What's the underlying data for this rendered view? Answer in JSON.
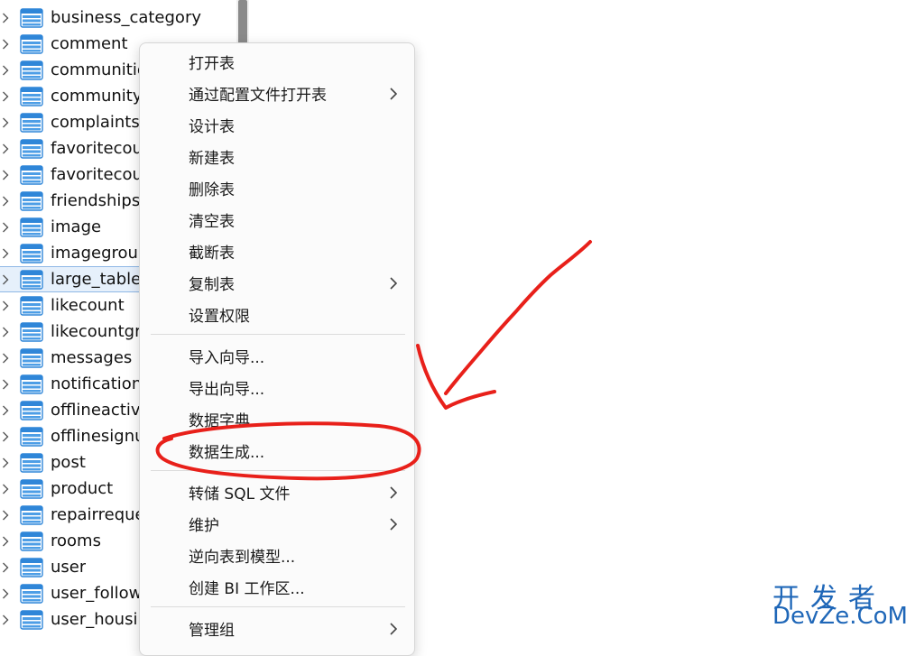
{
  "tree": {
    "items": [
      "business_category",
      "comment",
      "communitie",
      "community",
      "complaints",
      "favoritecou",
      "favoritecou",
      "friendships",
      "image",
      "imagegroup",
      "large_table",
      "likecount",
      "likecountgr",
      "messages",
      "notification",
      "offlineactivi",
      "offlinesignu",
      "post",
      "product",
      "repairreque",
      "rooms",
      "user",
      "user_follow",
      "user_housir"
    ],
    "selected_index": 10
  },
  "context_menu": {
    "items": [
      {
        "label": "打开表",
        "submenu": false
      },
      {
        "label": "通过配置文件打开表",
        "submenu": true
      },
      {
        "label": "设计表",
        "submenu": false
      },
      {
        "label": "新建表",
        "submenu": false
      },
      {
        "label": "删除表",
        "submenu": false
      },
      {
        "label": "清空表",
        "submenu": false
      },
      {
        "label": "截断表",
        "submenu": false
      },
      {
        "label": "复制表",
        "submenu": true
      },
      {
        "label": "设置权限",
        "submenu": false
      },
      {
        "label": "导入向导...",
        "submenu": false
      },
      {
        "label": "导出向导...",
        "submenu": false
      },
      {
        "label": "数据字典...",
        "submenu": false
      },
      {
        "label": "数据生成...",
        "submenu": false,
        "highlighted": true
      },
      {
        "label": "转储 SQL 文件",
        "submenu": true
      },
      {
        "label": "维护",
        "submenu": true
      },
      {
        "label": "逆向表到模型...",
        "submenu": false
      },
      {
        "label": "创建 BI 工作区...",
        "submenu": false
      },
      {
        "label": "管理组",
        "submenu": true
      }
    ]
  },
  "watermark": {
    "line1": "开发者",
    "line2": "DevZe.CoM"
  },
  "colors": {
    "annotation_red": "#e8201a",
    "table_icon_blue": "#2f86d8",
    "watermark_blue": "#1f67b8",
    "selected_row": "#e6f0fb"
  }
}
